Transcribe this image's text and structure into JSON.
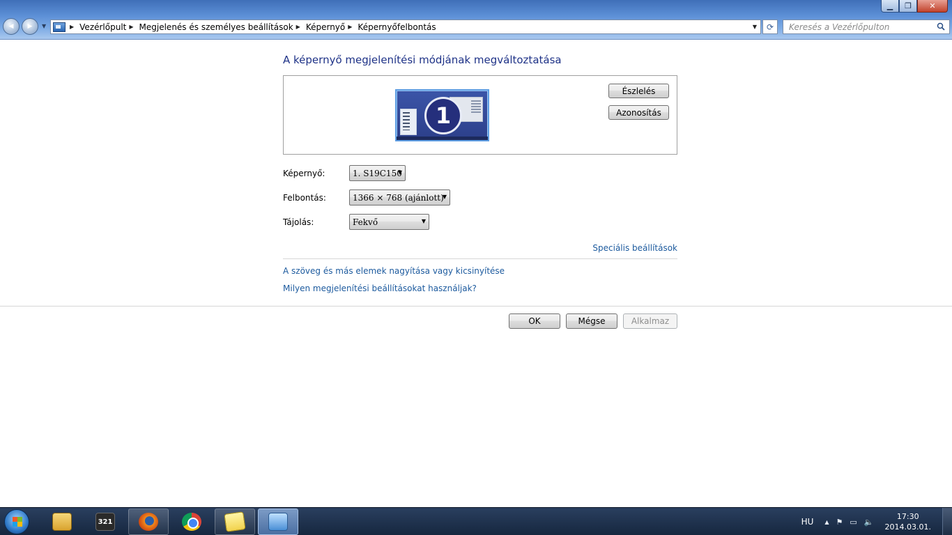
{
  "window": {
    "controls": {
      "minimize": "▁",
      "maximize": "❐",
      "close": "✕"
    }
  },
  "nav": {
    "back_icon": "◀",
    "forward_icon": "▶",
    "dropdown": "▼"
  },
  "breadcrumb": {
    "items": [
      "Vezérlőpult",
      "Megjelenés és személyes beállítások",
      "Képernyő",
      "Képernyőfelbontás"
    ],
    "separator": "▶",
    "dropdown": "▼"
  },
  "refresh": {
    "icon": "⟳"
  },
  "search": {
    "placeholder": "Keresés a Vezérlőpulton"
  },
  "main": {
    "title": "A képernyő megjelenítési módjának megváltoztatása",
    "monitor_number": "1",
    "detect_button": "Észlelés",
    "identify_button": "Azonosítás",
    "display_label": "Képernyő:",
    "display_value": "1. S19C150",
    "resolution_label": "Felbontás:",
    "resolution_value": "1366 × 768 (ajánlott)",
    "orientation_label": "Tájolás:",
    "orientation_value": "Fekvő",
    "combo_arrow": "▼",
    "advanced_link": "Speciális beállítások",
    "text_size_link": "A szöveg és más elemek nagyítása vagy kicsinyítése",
    "which_settings_link": "Milyen megjelenítési beállításokat használjak?"
  },
  "dialog_buttons": {
    "ok": "OK",
    "cancel": "Mégse",
    "apply": "Alkalmaz"
  },
  "taskbar": {
    "items": [
      {
        "name": "windows-explorer",
        "active": false
      },
      {
        "name": "media-player-classic",
        "label": "321",
        "active": false
      },
      {
        "name": "firefox",
        "active": false,
        "open": true
      },
      {
        "name": "chrome",
        "active": false
      },
      {
        "name": "sticky-notes",
        "active": false,
        "open": true
      },
      {
        "name": "display-settings",
        "active": true
      }
    ],
    "tray": {
      "language": "HU",
      "show_hidden_icon": "▲",
      "flag_icon": "⚑",
      "network_icon": "▭",
      "volume_icon": "🔈",
      "time": "17:30",
      "date": "2014.03.01."
    }
  },
  "colors": {
    "title_blue": "#1e3287",
    "link_blue": "#1c5a9e",
    "taskbar": "#16273f"
  }
}
